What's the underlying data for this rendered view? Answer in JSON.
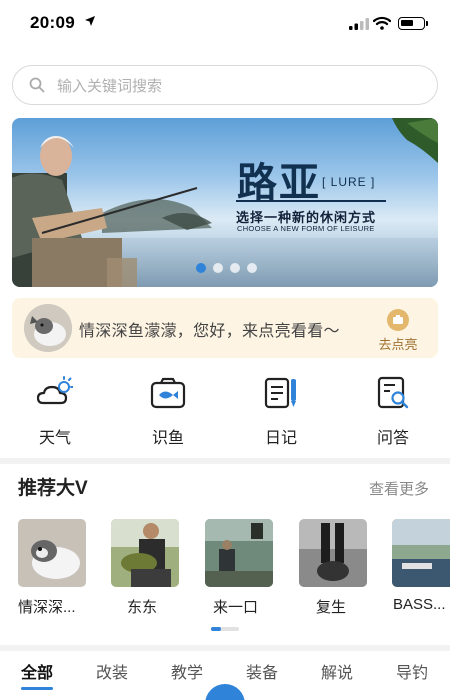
{
  "status_bar": {
    "time": "20:09"
  },
  "search": {
    "placeholder": "输入关键词搜索"
  },
  "banner": {
    "title": "路亚",
    "lure_label": "[ LURE ]",
    "subtitle": "选择一种新的休闲方式",
    "subtitle_en": "CHOOSE A NEW FORM OF  LEISURE",
    "dots": 4,
    "active_dot": 1
  },
  "notice": {
    "text": "情深深鱼濛濛，您好，来点亮看看～",
    "action": "去点亮"
  },
  "tools": [
    {
      "label": "天气",
      "icon": "weather-icon"
    },
    {
      "label": "识鱼",
      "icon": "fish-camera-icon"
    },
    {
      "label": "日记",
      "icon": "diary-icon"
    },
    {
      "label": "问答",
      "icon": "qa-icon"
    }
  ],
  "recommend": {
    "title": "推荐大V",
    "more": "查看更多",
    "items": [
      {
        "name": "情深深..."
      },
      {
        "name": "东东"
      },
      {
        "name": "来一口"
      },
      {
        "name": "复生"
      },
      {
        "name": "BASS..."
      }
    ]
  },
  "tabs": [
    {
      "label": "全部",
      "active": true
    },
    {
      "label": "改装"
    },
    {
      "label": "教学"
    },
    {
      "label": "装备"
    },
    {
      "label": "解说"
    },
    {
      "label": "导钓"
    }
  ],
  "colors": {
    "accent": "#2f83d9",
    "notice_bg": "#fdf4e3",
    "checkin": "#e3b86c"
  }
}
